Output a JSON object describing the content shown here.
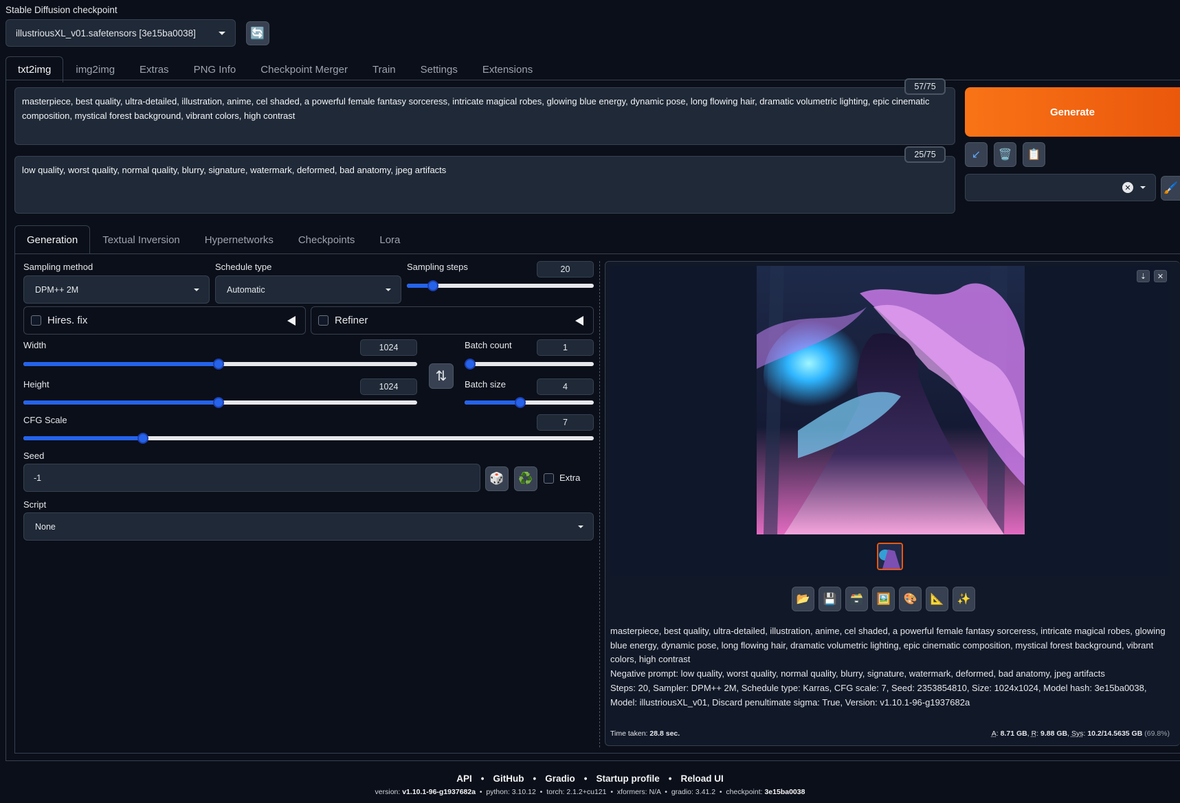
{
  "checkpoint": {
    "label": "Stable Diffusion checkpoint",
    "value": "illustriousXL_v01.safetensors [3e15ba0038]",
    "refresh_icon": "🔄"
  },
  "main_tabs": [
    "txt2img",
    "img2img",
    "Extras",
    "PNG Info",
    "Checkpoint Merger",
    "Train",
    "Settings",
    "Extensions"
  ],
  "prompt": {
    "text": "masterpiece, best quality, ultra-detailed, illustration, anime, cel shaded, a powerful female fantasy sorceress, intricate magical robes, glowing blue energy, dynamic pose, long flowing hair, dramatic volumetric lighting, epic cinematic composition, mystical forest background, vibrant colors, high contrast",
    "counter": "57/75"
  },
  "negative_prompt": {
    "text": "low quality, worst quality, normal quality, blurry, signature, watermark, deformed, bad anatomy, jpeg artifacts",
    "counter": "25/75"
  },
  "generate_label": "Generate",
  "tool_icons": {
    "read": "↙",
    "trash": "🗑️",
    "paste": "📋",
    "edit": "🖌️"
  },
  "sub_tabs": [
    "Generation",
    "Textual Inversion",
    "Hypernetworks",
    "Checkpoints",
    "Lora"
  ],
  "sampling": {
    "method_label": "Sampling method",
    "method_value": "DPM++ 2M",
    "schedule_label": "Schedule type",
    "schedule_value": "Automatic",
    "steps_label": "Sampling steps",
    "steps_value": "20",
    "steps_fraction": 0.14
  },
  "hires_label": "Hires. fix",
  "refiner_label": "Refiner",
  "width": {
    "label": "Width",
    "value": "1024",
    "fraction": 0.495
  },
  "height": {
    "label": "Height",
    "value": "1024",
    "fraction": 0.495
  },
  "swap_icon": "⇅",
  "batch_count": {
    "label": "Batch count",
    "value": "1",
    "fraction": 0.0
  },
  "batch_size": {
    "label": "Batch size",
    "value": "4",
    "fraction": 0.43
  },
  "cfg": {
    "label": "CFG Scale",
    "value": "7",
    "fraction": 0.21
  },
  "seed": {
    "label": "Seed",
    "value": "-1",
    "dice_icon": "🎲",
    "recycle_icon": "♻️",
    "extra_label": "Extra"
  },
  "script": {
    "label": "Script",
    "value": "None"
  },
  "output": {
    "download_icon": "⇣",
    "close_icon": "✕",
    "buttons": [
      "📂",
      "💾",
      "🗃️",
      "🖼️",
      "🎨",
      "📐",
      "✨"
    ],
    "info_positive": "masterpiece, best quality, ultra-detailed, illustration, anime, cel shaded, a powerful female fantasy sorceress, intricate magical robes, glowing blue energy, dynamic pose, long flowing hair, dramatic volumetric lighting, epic cinematic composition, mystical forest background, vibrant colors, high contrast",
    "info_negative": "Negative prompt: low quality, worst quality, normal quality, blurry, signature, watermark, deformed, bad anatomy, jpeg artifacts",
    "info_params": "Steps: 20, Sampler: DPM++ 2M, Schedule type: Karras, CFG scale: 7, Seed: 2353854810, Size: 1024x1024, Model hash: 3e15ba0038, Model: illustriousXL_v01, Discard penultimate sigma: True, Version: v1.10.1-96-g1937682a",
    "time_label": "Time taken:",
    "time_value": "28.8 sec.",
    "mem_a_label": "A",
    "mem_a": "8.71 GB",
    "mem_r_label": "R",
    "mem_r": "9.88 GB",
    "mem_sys_label": "Sys",
    "mem_sys": "10.2/14.5635 GB",
    "mem_pct": "(69.8%)"
  },
  "footer": {
    "links": [
      "API",
      "GitHub",
      "Gradio",
      "Startup profile",
      "Reload UI"
    ],
    "version_label": "version:",
    "version": "v1.10.1-96-g1937682a",
    "python_label": "python:",
    "python": "3.10.12",
    "torch_label": "torch:",
    "torch": "2.1.2+cu121",
    "xformers_label": "xformers:",
    "xformers": "N/A",
    "gradio_label": "gradio:",
    "gradio": "3.41.2",
    "checkpoint_label": "checkpoint:",
    "checkpoint": "3e15ba0038"
  },
  "colors": {
    "accent": "#ea580c",
    "slider": "#2563eb",
    "background": "#0b0f19"
  }
}
